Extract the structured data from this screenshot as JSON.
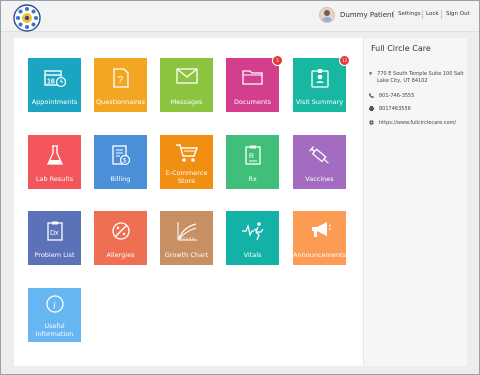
{
  "header": {
    "user_name": "Dummy Patient",
    "links": [
      "Settings",
      "Lock",
      "Sign Out"
    ]
  },
  "tiles": [
    {
      "label": "Appointments",
      "color": "#1aa6c2",
      "icon": "calendar-icon"
    },
    {
      "label": "Questionnaires",
      "color": "#f3a622",
      "icon": "question-doc-icon"
    },
    {
      "label": "Messages",
      "color": "#8cc43f",
      "icon": "envelope-icon"
    },
    {
      "label": "Documents",
      "color": "#d43f8d",
      "icon": "folder-icon",
      "badge": "5"
    },
    {
      "label": "Visit Summary",
      "color": "#18b7a1",
      "icon": "id-card-icon",
      "badge": "12"
    },
    {
      "label": "Lab Results",
      "color": "#f2565a",
      "icon": "flask-icon"
    },
    {
      "label": "Billing",
      "color": "#4a8fd8",
      "icon": "bill-icon"
    },
    {
      "label": "E-Commerce Store",
      "color": "#f08f12",
      "icon": "cart-icon"
    },
    {
      "label": "Rx",
      "color": "#3fbf79",
      "icon": "rx-icon"
    },
    {
      "label": "Vaccines",
      "color": "#a36cc0",
      "icon": "syringe-icon"
    },
    {
      "label": "Problem List",
      "color": "#5b71b8",
      "icon": "dx-clipboard-icon"
    },
    {
      "label": "Allergies",
      "color": "#ef6f52",
      "icon": "allergy-pill-icon"
    },
    {
      "label": "Growth Chart",
      "color": "#c88f62",
      "icon": "growth-chart-icon"
    },
    {
      "label": "Vitals",
      "color": "#12b3a6",
      "icon": "vitals-runner-icon"
    },
    {
      "label": "Announcements",
      "color": "#fc9b53",
      "icon": "megaphone-icon"
    },
    {
      "label": "Useful Information",
      "color": "#66b6f2",
      "icon": "info-icon"
    }
  ],
  "practice": {
    "name": "Full Circle Care",
    "address": "770 E South Temple Suite 100 Salt Lake City, UT 84102",
    "phone": "801-746-3555",
    "fax": "8017463556",
    "website": "https://www.fullcirclecare.com/"
  }
}
